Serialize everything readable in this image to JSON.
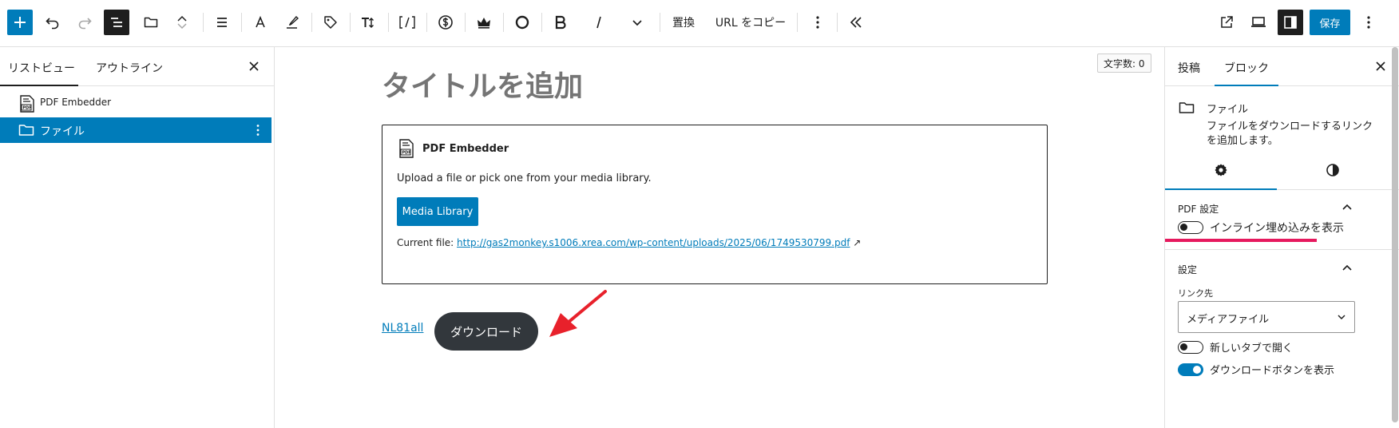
{
  "toolbar": {
    "replace_label": "置換",
    "copy_url_label": "URL をコピー",
    "save_label": "保存"
  },
  "list_view": {
    "tab_list": "リストビュー",
    "tab_outline": "アウトライン",
    "items": [
      {
        "label": "PDF Embedder",
        "icon": "pdf-icon",
        "selected": false
      },
      {
        "label": "ファイル",
        "icon": "folder-icon",
        "selected": true
      }
    ]
  },
  "editor": {
    "word_count": "文字数: 0",
    "title_placeholder": "タイトルを追加",
    "pdf_block": {
      "title": "PDF Embedder",
      "instructions": "Upload a file or pick one from your media library.",
      "media_button": "Media Library",
      "current_file_label": "Current file:",
      "current_file_url": "http://gas2monkey.s1006.xrea.com/wp-content/uploads/2025/06/1749530799.pdf",
      "external_icon": "↗"
    },
    "file_block": {
      "link_text": "NL81all",
      "download_button": "ダウンロード"
    }
  },
  "sidebar": {
    "tab_post": "投稿",
    "tab_block": "ブロック",
    "block_card": {
      "name": "ファイル",
      "description": "ファイルをダウンロードするリンクを追加します。"
    },
    "pdf_settings": {
      "heading": "PDF 設定",
      "inline_toggle_label": "インライン埋め込みを表示",
      "inline_toggle_on": false
    },
    "settings": {
      "heading": "設定",
      "link_to_label": "リンク先",
      "link_to_value": "メディアファイル",
      "new_tab_label": "新しいタブで開く",
      "new_tab_on": false,
      "download_button_label": "ダウンロードボタンを表示",
      "download_button_on": true
    }
  },
  "colors": {
    "accent": "#007cba",
    "dark": "#1e1e1e",
    "annotation_red": "#e8212b",
    "annotation_pink": "#e6195e",
    "download_button_bg": "#32373c"
  }
}
